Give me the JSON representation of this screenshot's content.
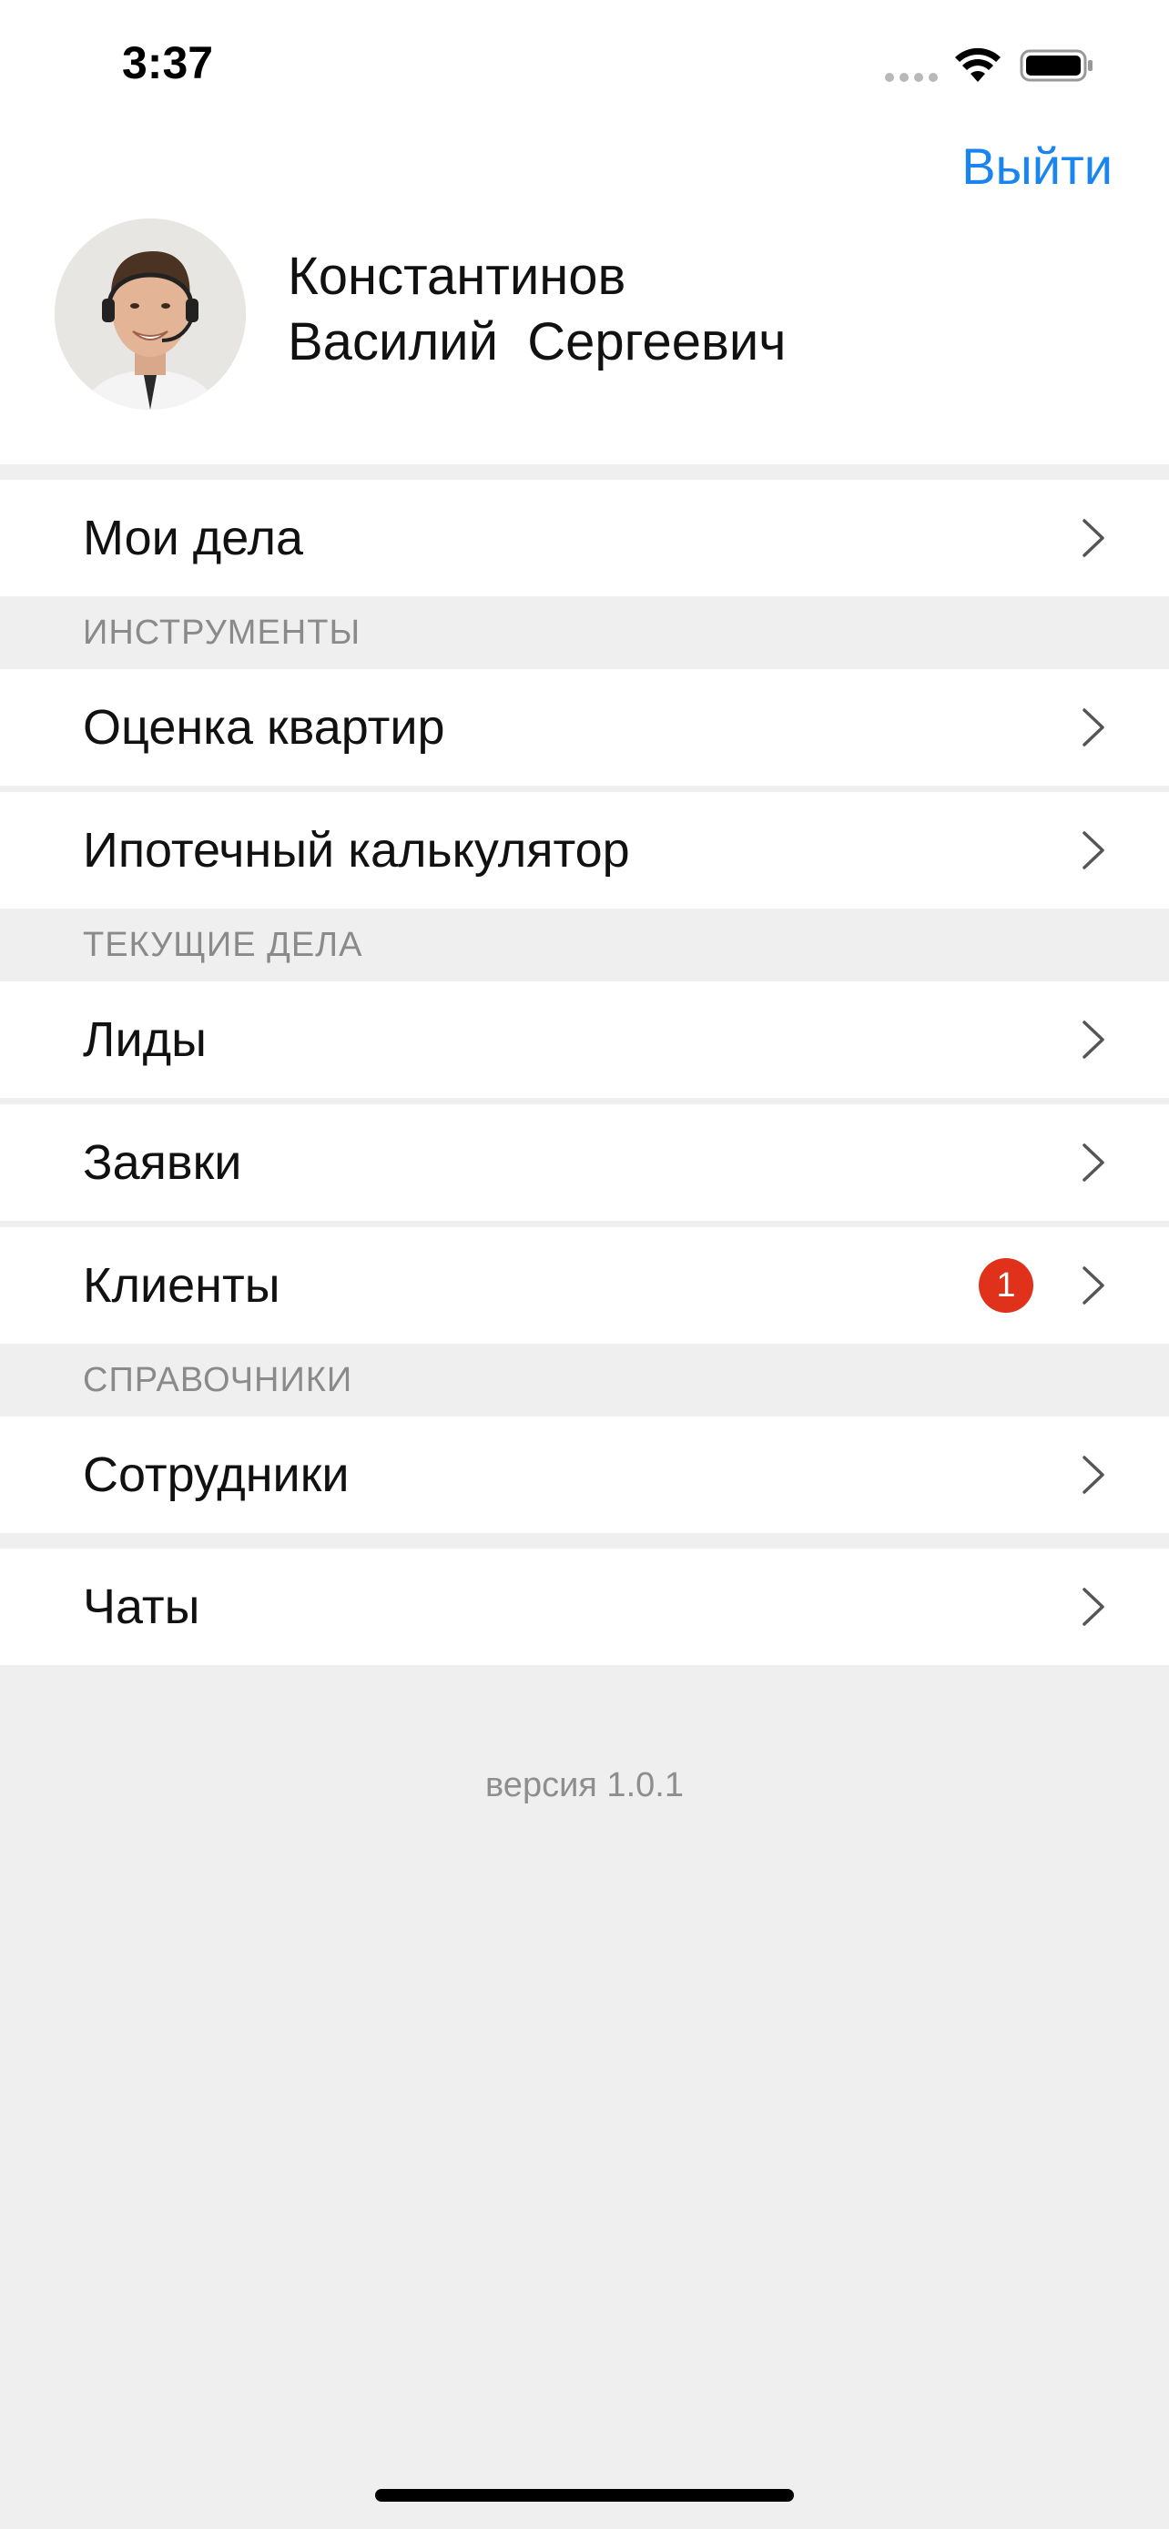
{
  "status_bar": {
    "time": "3:37",
    "icons": [
      "signal-dots-icon",
      "wifi-icon",
      "battery-icon"
    ]
  },
  "header": {
    "logout_label": "Выйти",
    "name_line1": "Константинов",
    "name_line2": "Василий  Сергеевич",
    "accent_color": "#1a84ef"
  },
  "menu": {
    "my_tasks": {
      "label": "Мои дела"
    },
    "section_tools": "ИНСТРУМЕНТЫ",
    "apartment_valuation": {
      "label": "Оценка квартир"
    },
    "mortgage_calculator": {
      "label": "Ипотечный калькулятор"
    },
    "section_current": "ТЕКУЩИЕ ДЕЛА",
    "leads": {
      "label": "Лиды"
    },
    "requests": {
      "label": "Заявки"
    },
    "clients": {
      "label": "Клиенты",
      "badge": "1"
    },
    "section_directories": "СПРАВОЧНИКИ",
    "employees": {
      "label": "Сотрудники"
    },
    "chats": {
      "label": "Чаты"
    }
  },
  "footer": {
    "version": "версия 1.0.1"
  },
  "colors": {
    "badge": "#e0321a",
    "background": "#efefef"
  }
}
